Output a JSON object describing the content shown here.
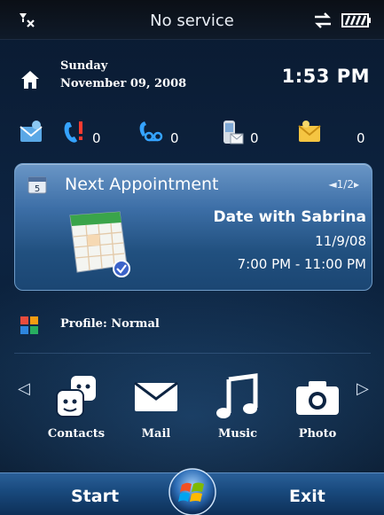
{
  "status_bar": {
    "carrier_text": "No service",
    "icons": [
      "signal-off-icon",
      "data-sync-icon",
      "battery-icon"
    ]
  },
  "home": {
    "day": "Sunday",
    "date": "November 09, 2008",
    "time": "1:53 PM"
  },
  "notifications": [
    {
      "name": "messaging-icon",
      "count": ""
    },
    {
      "name": "missed-call-icon",
      "count": "0"
    },
    {
      "name": "voicemail-icon",
      "count": "0"
    },
    {
      "name": "text-message-icon",
      "count": "0"
    },
    {
      "name": "email-icon",
      "count": "0"
    }
  ],
  "appointment": {
    "title": "Next Appointment",
    "pager": "◄1/2▸",
    "subject": "Date with Sabrina",
    "date": "11/9/08",
    "time": "7:00 PM - 11:00 PM"
  },
  "profile": {
    "label": "Profile: Normal"
  },
  "launcher": {
    "apps": [
      {
        "label": "Contacts"
      },
      {
        "label": "Mail"
      },
      {
        "label": "Music"
      },
      {
        "label": "Photo"
      }
    ]
  },
  "softkeys": {
    "left": "Start",
    "right": "Exit"
  },
  "colors": {
    "accent": "#2f6aa6",
    "card": "#3d6fa7",
    "background": "#0d2442"
  }
}
